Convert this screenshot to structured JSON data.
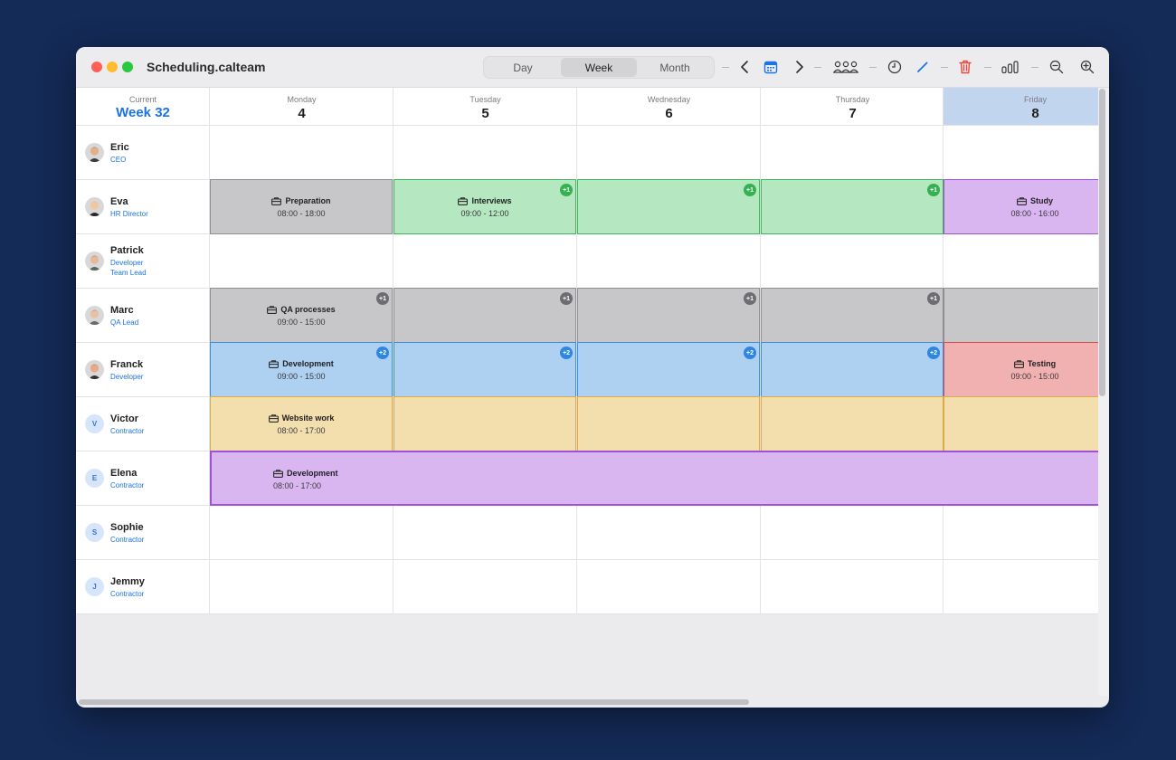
{
  "app": {
    "title": "Scheduling.calteam"
  },
  "views": {
    "day": "Day",
    "week": "Week",
    "month": "Month",
    "active": "week"
  },
  "toolbar": {
    "icons": [
      "chevron-left-icon",
      "calendar-icon",
      "chevron-right-icon",
      "team-icon",
      "clock-icon",
      "pen-icon",
      "trash-icon",
      "bar-chart-icon",
      "zoom-out-icon",
      "zoom-in-icon"
    ],
    "accent": "#1a73e8",
    "danger": "#e5483f"
  },
  "header": {
    "current_label": "Current",
    "week_label": "Week 32"
  },
  "days": [
    {
      "name": "Monday",
      "num": "4"
    },
    {
      "name": "Tuesday",
      "num": "5"
    },
    {
      "name": "Wednesday",
      "num": "6"
    },
    {
      "name": "Thursday",
      "num": "7"
    },
    {
      "name": "Friday",
      "num": "8",
      "today": true
    }
  ],
  "people": [
    {
      "name": "Eric",
      "roles": [
        "CEO"
      ],
      "avatar": "photo"
    },
    {
      "name": "Eva",
      "roles": [
        "HR Director"
      ],
      "avatar": "photo"
    },
    {
      "name": "Patrick",
      "roles": [
        "Developer",
        "Team Lead"
      ],
      "avatar": "photo"
    },
    {
      "name": "Marc",
      "roles": [
        "QA Lead"
      ],
      "avatar": "photo"
    },
    {
      "name": "Franck",
      "roles": [
        "Developer"
      ],
      "avatar": "photo"
    },
    {
      "name": "Victor",
      "roles": [
        "Contractor"
      ],
      "avatar": "V"
    },
    {
      "name": "Elena",
      "roles": [
        "Contractor"
      ],
      "avatar": "E"
    },
    {
      "name": "Sophie",
      "roles": [
        "Contractor"
      ],
      "avatar": "S"
    },
    {
      "name": "Jemmy",
      "roles": [
        "Contractor"
      ],
      "avatar": "J"
    }
  ],
  "events": [
    {
      "person": 1,
      "day": 0,
      "span": 1,
      "title": "Preparation",
      "time": "08:00 - 18:00",
      "color": "gray"
    },
    {
      "person": 1,
      "day": 1,
      "span": 1,
      "title": "Interviews",
      "time": "09:00 - 12:00",
      "color": "green",
      "badge": "+1"
    },
    {
      "person": 1,
      "day": 2,
      "span": 1,
      "title": "",
      "time": "",
      "color": "green",
      "badge": "+1"
    },
    {
      "person": 1,
      "day": 3,
      "span": 1,
      "title": "",
      "time": "",
      "color": "green",
      "badge": "+1"
    },
    {
      "person": 1,
      "day": 4,
      "span": 1,
      "title": "Study",
      "time": "08:00 - 16:00",
      "color": "purple"
    },
    {
      "person": 3,
      "day": 0,
      "span": 1,
      "title": "QA processes",
      "time": "09:00 - 15:00",
      "color": "gray",
      "badge": "+1"
    },
    {
      "person": 3,
      "day": 1,
      "span": 1,
      "title": "",
      "time": "",
      "color": "gray",
      "badge": "+1"
    },
    {
      "person": 3,
      "day": 2,
      "span": 1,
      "title": "",
      "time": "",
      "color": "gray",
      "badge": "+1"
    },
    {
      "person": 3,
      "day": 3,
      "span": 1,
      "title": "",
      "time": "",
      "color": "gray",
      "badge": "+1"
    },
    {
      "person": 3,
      "day": 4,
      "span": 1,
      "title": "",
      "time": "",
      "color": "gray"
    },
    {
      "person": 4,
      "day": 0,
      "span": 1,
      "title": "Development",
      "time": "09:00 - 15:00",
      "color": "blue",
      "badge": "+2"
    },
    {
      "person": 4,
      "day": 1,
      "span": 1,
      "title": "",
      "time": "",
      "color": "blue",
      "badge": "+2"
    },
    {
      "person": 4,
      "day": 2,
      "span": 1,
      "title": "",
      "time": "",
      "color": "blue",
      "badge": "+2"
    },
    {
      "person": 4,
      "day": 3,
      "span": 1,
      "title": "",
      "time": "",
      "color": "blue",
      "badge": "+2"
    },
    {
      "person": 4,
      "day": 4,
      "span": 1,
      "title": "Testing",
      "time": "09:00 - 15:00",
      "color": "red"
    },
    {
      "person": 5,
      "day": 0,
      "span": 1,
      "title": "Website work",
      "time": "08:00 - 17:00",
      "color": "orange"
    },
    {
      "person": 5,
      "day": 1,
      "span": 1,
      "title": "",
      "time": "",
      "color": "orange"
    },
    {
      "person": 5,
      "day": 2,
      "span": 1,
      "title": "",
      "time": "",
      "color": "orange"
    },
    {
      "person": 5,
      "day": 3,
      "span": 1,
      "title": "",
      "time": "",
      "color": "orange"
    },
    {
      "person": 5,
      "day": 4,
      "span": 1,
      "title": "",
      "time": "",
      "color": "orange"
    },
    {
      "person": 6,
      "day": 0,
      "span": 5,
      "title": "Development",
      "time": "08:00 - 17:00",
      "color": "purple",
      "selected": true
    }
  ]
}
